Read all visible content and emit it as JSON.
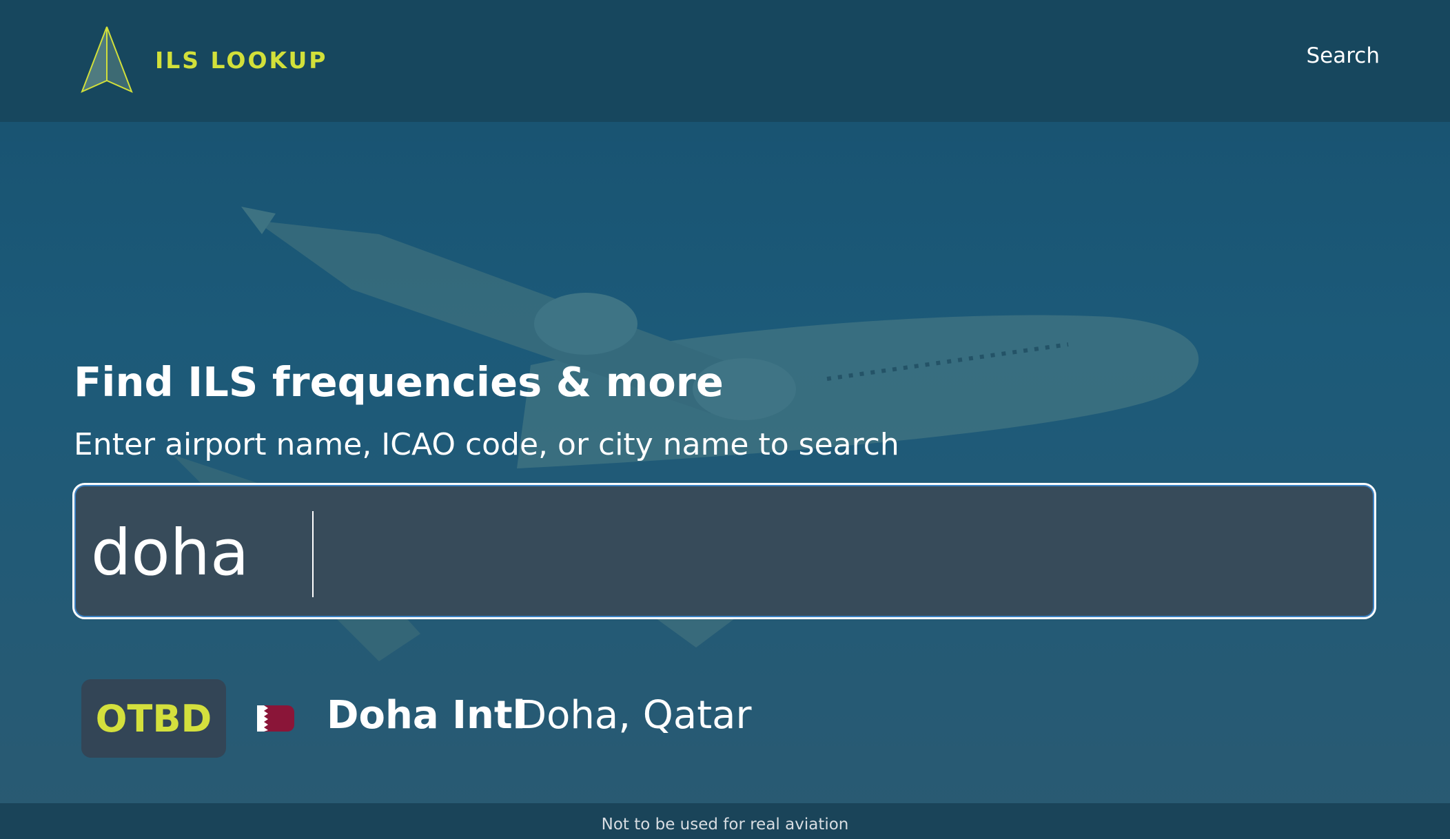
{
  "header": {
    "brand": "ILS LOOKUP",
    "nav_search": "Search",
    "logo_icon": "navigation-arrow-icon"
  },
  "hero": {
    "headline": "Find ILS frequencies & more",
    "subline": "Enter airport name, ICAO code, or city name to search",
    "search_value": "doha"
  },
  "results": [
    {
      "icao": "OTBD",
      "flag_icon": "qatar-flag-icon",
      "name": "Doha Intl",
      "location": "Doha, Qatar"
    }
  ],
  "footer": {
    "disclaimer": "Not to be used for real aviation"
  },
  "colors": {
    "brand_accent": "#d2e03a",
    "header_bg": "#17475e",
    "search_bg": "#374b5a",
    "badge_bg": "#334556",
    "flag_maroon": "#8a1538"
  }
}
